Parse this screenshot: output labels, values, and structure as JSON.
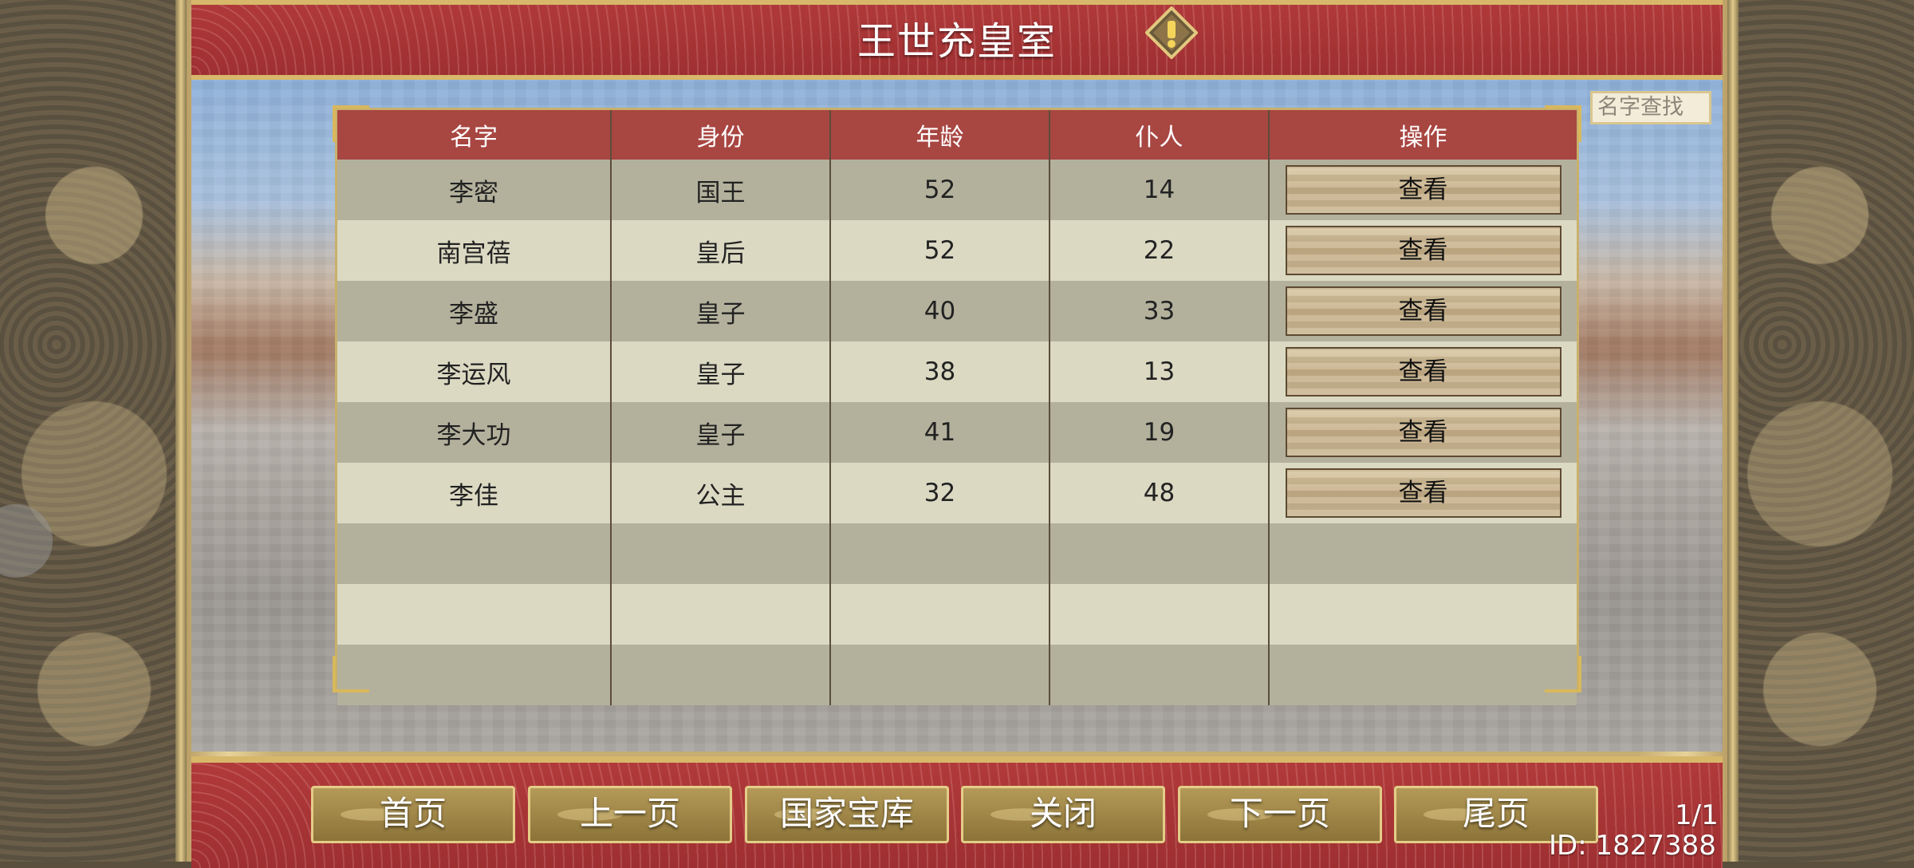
{
  "header": {
    "title": "王世充皇室"
  },
  "search": {
    "placeholder": "名字查找"
  },
  "table": {
    "columns": [
      "名字",
      "身份",
      "年龄",
      "仆人",
      "操作"
    ],
    "rows": [
      {
        "name": "李密",
        "identity": "国王",
        "age": "52",
        "servants": "14",
        "action": "查看"
      },
      {
        "name": "南宫蓓",
        "identity": "皇后",
        "age": "52",
        "servants": "22",
        "action": "查看"
      },
      {
        "name": "李盛",
        "identity": "皇子",
        "age": "40",
        "servants": "33",
        "action": "查看"
      },
      {
        "name": "李运风",
        "identity": "皇子",
        "age": "38",
        "servants": "13",
        "action": "查看"
      },
      {
        "name": "李大功",
        "identity": "皇子",
        "age": "41",
        "servants": "19",
        "action": "查看"
      },
      {
        "name": "李佳",
        "identity": "公主",
        "age": "32",
        "servants": "48",
        "action": "查看"
      }
    ]
  },
  "footer": {
    "buttons": [
      "首页",
      "上一页",
      "国家宝库",
      "关闭",
      "下一页",
      "尾页"
    ],
    "page": "1/1",
    "id": "ID: 1827388"
  },
  "colors": {
    "header_red": "#a84642",
    "gold": "#d7b86a",
    "row_dark": "#b3b19c",
    "row_light": "#dbd9c2"
  }
}
